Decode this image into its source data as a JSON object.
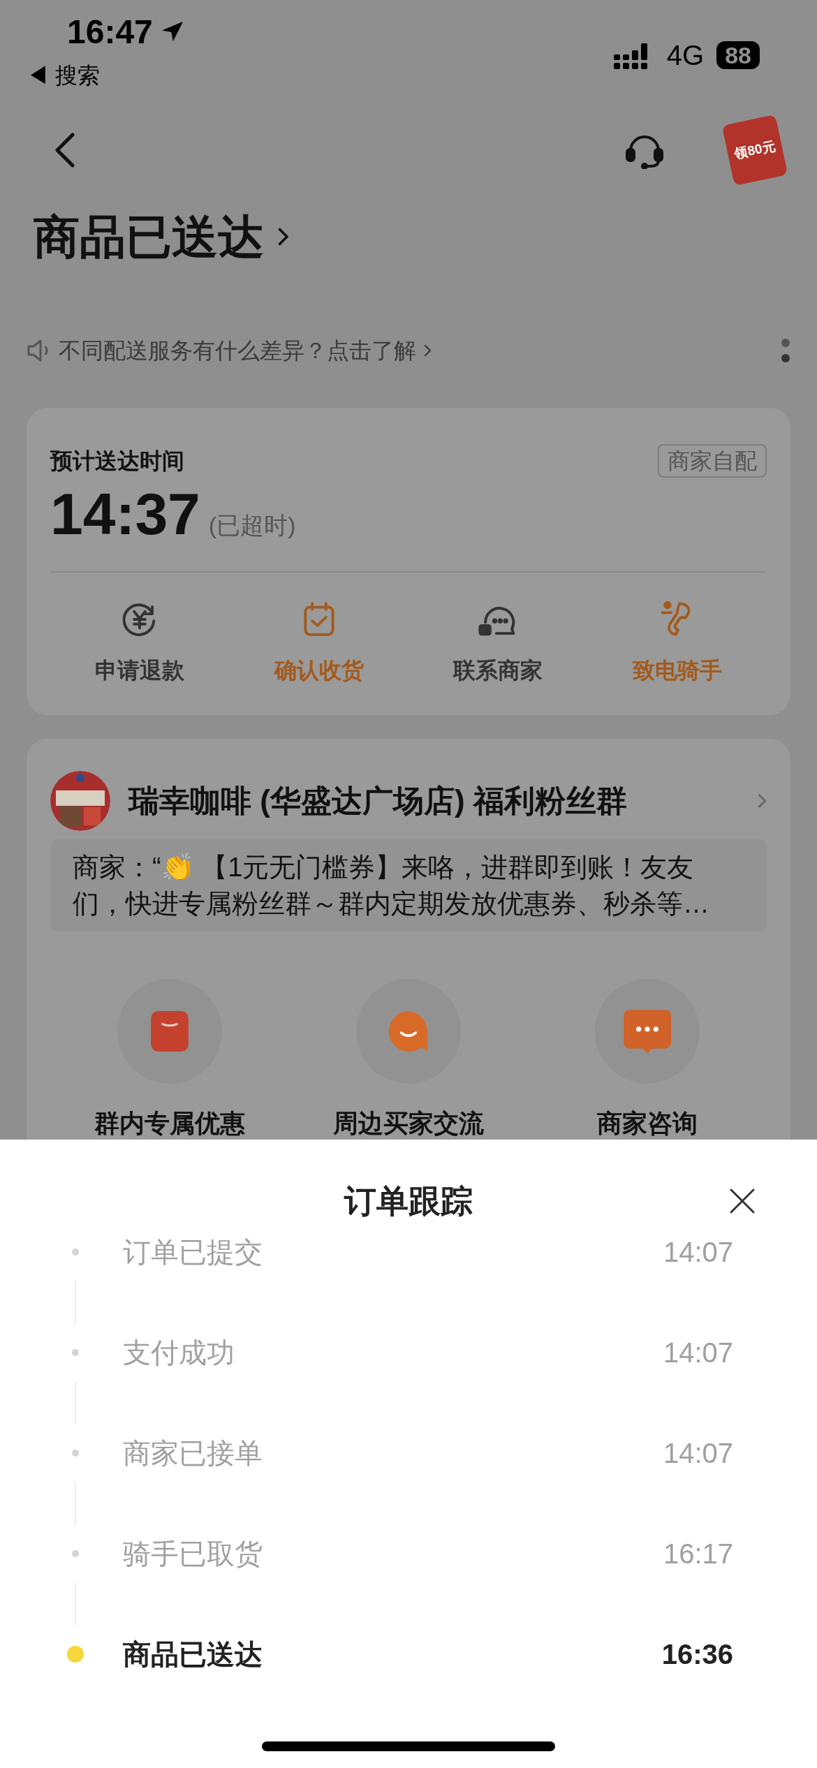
{
  "status_bar": {
    "time": "16:47",
    "back_app": "◀ 搜索",
    "network": "4G",
    "battery": "88"
  },
  "nav": {
    "coupon_badge": "领80元"
  },
  "title": "商品已送达",
  "notice": "不同配送服务有什么差异？点击了解",
  "delivery_card": {
    "label": "预计送达时间",
    "tag": "商家自配",
    "time": "14:37",
    "overdue": "(已超时)",
    "actions": [
      {
        "label": "申请退款",
        "highlighted": false
      },
      {
        "label": "确认收货",
        "highlighted": true
      },
      {
        "label": "联系商家",
        "highlighted": false
      },
      {
        "label": "致电骑手",
        "highlighted": true
      }
    ]
  },
  "group_card": {
    "name": "瑞幸咖啡 (华盛达广场店) 福利粉丝群",
    "message": "商家：“👏 【1元无门槛券】来咯，进群即到账！友友们，快进专属粉丝群～群内定期发放优惠券、秒杀等…",
    "features": [
      {
        "label": "群内专属优惠"
      },
      {
        "label": "周边买家交流"
      },
      {
        "label": "商家咨询"
      }
    ]
  },
  "sheet": {
    "title": "订单跟踪",
    "steps": [
      {
        "label": "订单已提交",
        "time": "14:07",
        "current": false
      },
      {
        "label": "支付成功",
        "time": "14:07",
        "current": false
      },
      {
        "label": "商家已接单",
        "time": "14:07",
        "current": false
      },
      {
        "label": "骑手已取货",
        "time": "16:17",
        "current": false
      },
      {
        "label": "商品已送达",
        "time": "16:36",
        "current": true
      }
    ]
  }
}
